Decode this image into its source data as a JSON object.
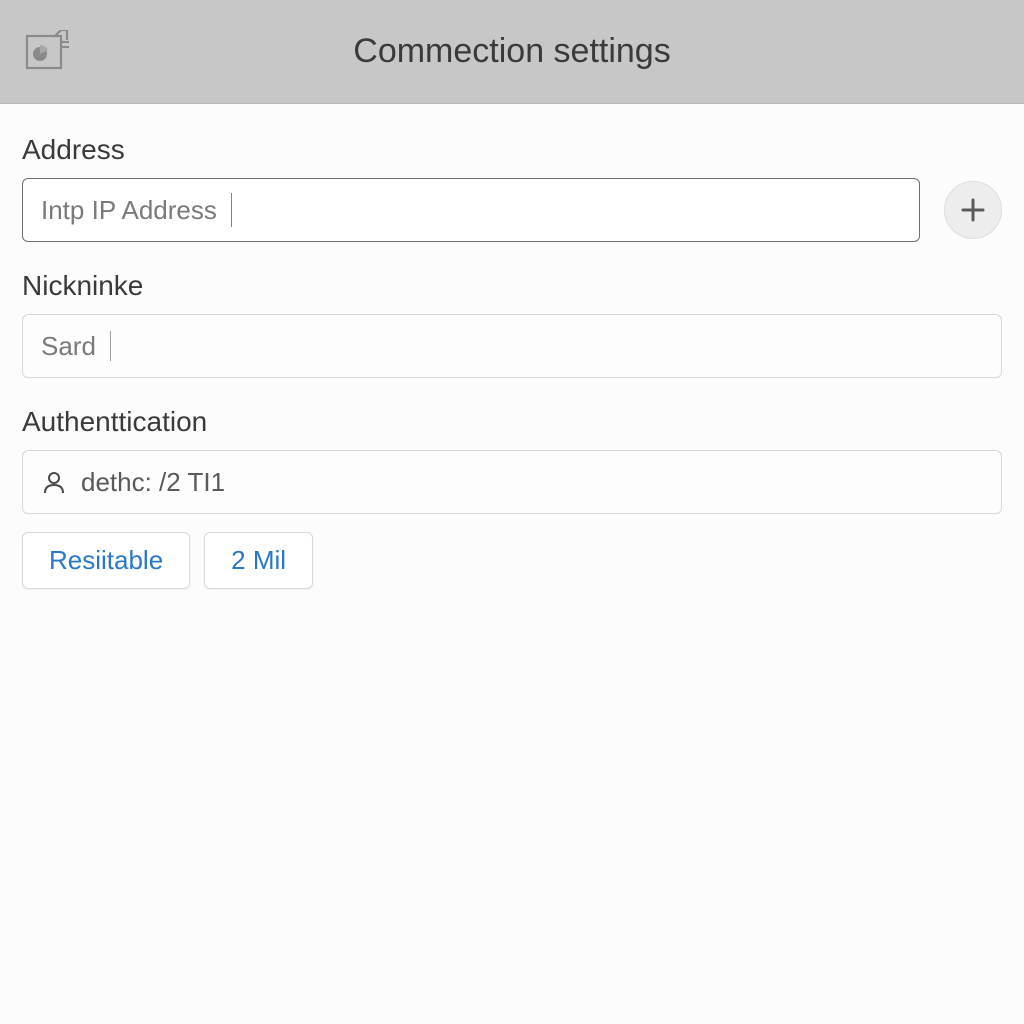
{
  "header": {
    "title": "Commection settings"
  },
  "fields": {
    "address": {
      "label": "Address",
      "placeholder": "Intp IP Address"
    },
    "nickname": {
      "label": "Nickninke",
      "value": "Sard"
    },
    "authentication": {
      "label": "Authenttication",
      "value": "dethc: /2 TI1"
    }
  },
  "buttons": {
    "resiitable": "Resiitable",
    "twomil": "2 Mil"
  }
}
